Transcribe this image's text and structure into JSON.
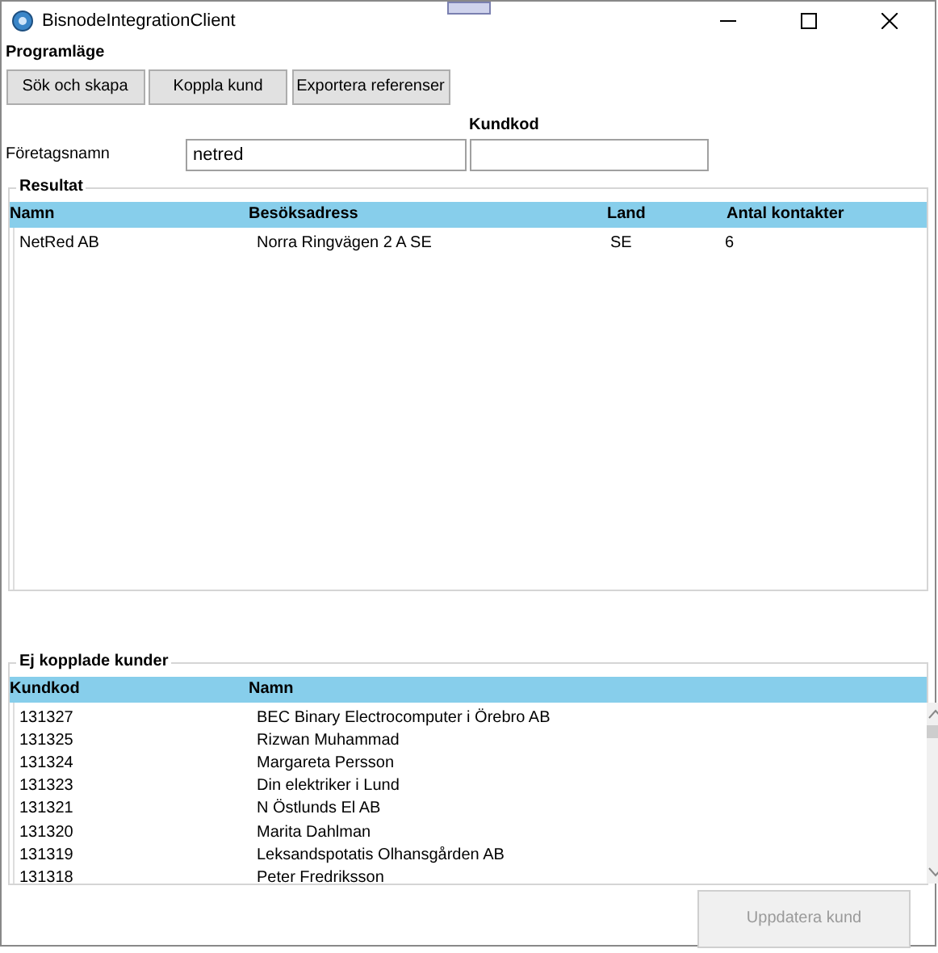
{
  "window": {
    "title": "BisnodeIntegrationClient"
  },
  "mode": {
    "label": "Programläge",
    "buttons": [
      {
        "label": "Sök och skapa"
      },
      {
        "label": "Koppla kund"
      },
      {
        "label": "Exportera referenser"
      }
    ]
  },
  "search": {
    "company_label": "Företagsnamn",
    "company_value": "netred",
    "code_label": "Kundkod"
  },
  "results": {
    "title": "Resultat",
    "columns": [
      "Namn",
      "Besöksadress",
      "Land",
      "Antal kontakter"
    ],
    "rows": [
      [
        "NetRed AB",
        "Norra Ringvägen 2 A SE",
        "SE",
        "6"
      ]
    ]
  },
  "unlinked": {
    "title": "Ej kopplade kunder",
    "columns": [
      "Kundkod",
      "Namn"
    ],
    "rows": [
      [
        "131327",
        "BEC Binary Electrocomputer i Örebro AB"
      ],
      [
        "131325",
        "Rizwan Muhammad"
      ],
      [
        "131324",
        "Margareta Persson"
      ],
      [
        "131323",
        "Din elektriker i Lund"
      ],
      [
        "131321",
        "N Östlunds El AB"
      ],
      [
        "131320",
        "Marita Dahlman"
      ],
      [
        "131319",
        "Leksandspotatis Olhansgården AB"
      ],
      [
        "131318",
        "Peter Fredriksson"
      ]
    ]
  },
  "update_button": {
    "label": "Uppdatera kund",
    "disabled": true
  }
}
